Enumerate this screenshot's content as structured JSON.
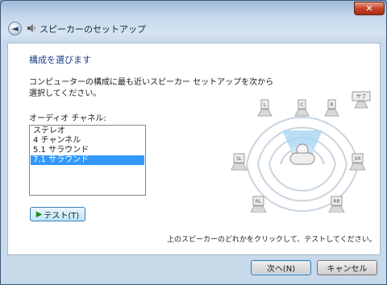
{
  "window": {
    "title": "スピーカーのセットアップ",
    "close_label": "✕",
    "back_label": "◄"
  },
  "main": {
    "heading": "構成を選びます",
    "description_lines": [
      "コンピューターの構成に最も近いスピーカー セットアップを次から",
      "選択してください。"
    ],
    "channel_label": "オーディオ チャネル:",
    "channels": [
      "ステレオ",
      "4 チャンネル",
      "5.1 サラウンド",
      "7.1 サラウンド"
    ],
    "selected_channel": "7.1 サラウンド",
    "test_button": "テスト(T)",
    "instruction": "上のスピーカーのどれかをクリックして、テストしてください。"
  },
  "speakers": {
    "labels": [
      "L",
      "C",
      "R",
      "サブ",
      "SL",
      "SR",
      "RL",
      "RR"
    ]
  },
  "footer": {
    "next_button": "次へ(N)",
    "cancel_button": "キャンセル"
  },
  "colors": {
    "accent": "#3399ff",
    "heading": "#1e3e8a",
    "close": "#c6452a"
  }
}
